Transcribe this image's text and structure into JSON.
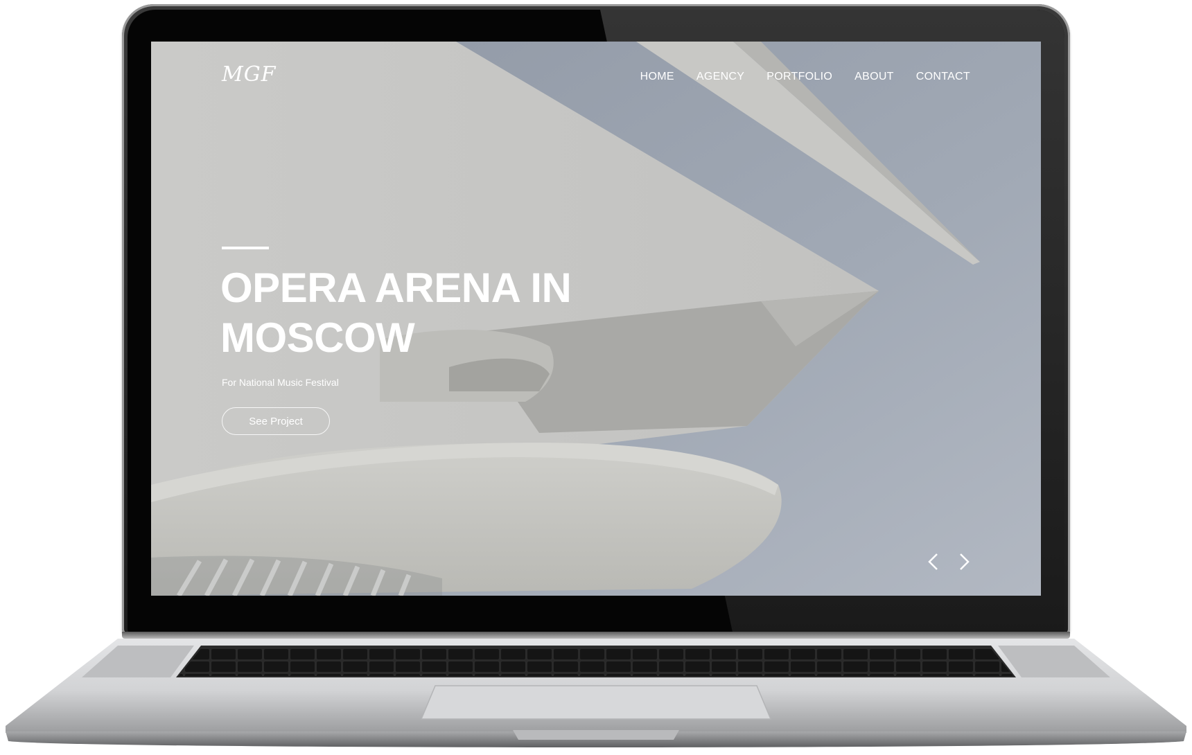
{
  "site": {
    "logo": "MGF",
    "nav": [
      "HOME",
      "AGENCY",
      "PORTFOLIO",
      "ABOUT",
      "CONTACT"
    ]
  },
  "hero": {
    "title": "OPERA ARENA IN MOSCOW",
    "subtitle": "For National Music Festival",
    "cta": "See Project"
  },
  "slider": {
    "prev_icon": "chevron-left-icon",
    "next_icon": "chevron-right-icon"
  },
  "colors": {
    "sky": "#9aa2ae",
    "concrete": "#c6c6c3",
    "text": "#ffffff",
    "bezel": "#050505",
    "aluminum": "#c9cacc"
  }
}
